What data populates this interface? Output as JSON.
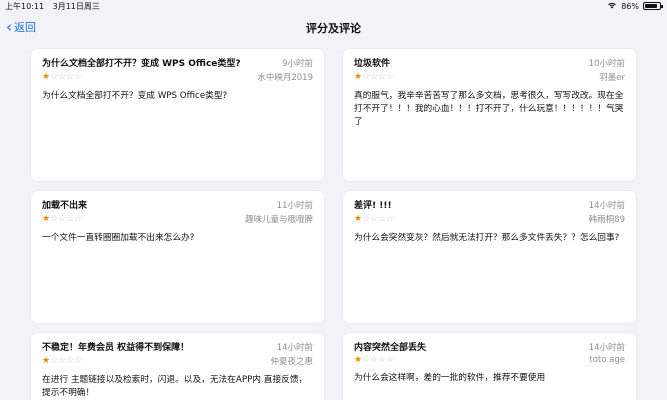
{
  "status_bar": {
    "time": "上午10:11",
    "date": "3月11日周三",
    "battery": "86%",
    "battery_fraction": 0.86
  },
  "nav": {
    "back_label": "返回",
    "title": "评分及评论"
  },
  "reviews": [
    {
      "title": "为什么文档全部打不开？变成 WPS Office类型?",
      "time": "9小时前",
      "author": "水中映月2019",
      "rating": 1,
      "body": "为什么文档全部打不开？变成 WPS Office类型?"
    },
    {
      "title": "垃圾软件",
      "time": "10小时前",
      "author": "羽墨er",
      "rating": 1,
      "body": "真的服气，我辛辛苦苦写了那么多文档，思考很久，写写改改。现在全打不开了！！！我的心血！！！打不开了，什么玩意！！！！！！气哭了"
    },
    {
      "title": "加载不出来",
      "time": "11小时前",
      "author": "趣味儿童与哦哦脾",
      "rating": 1,
      "body": "一个文件一直转圈圈加载不出来怎么办?"
    },
    {
      "title": "差评! !!!",
      "time": "14小时前",
      "author": "韩雨桐89",
      "rating": 1,
      "body": "为什么会突然变灰？然后就无法打开？那么多文件丢失？？怎么回事?"
    },
    {
      "title": "不稳定！年费会员 权益得不到保障！",
      "time": "14小时前",
      "author": "仲夏夜之惠",
      "rating": 1,
      "body": "在进行 主题链接以及检索时，闪退。以及，无法在APP内 直接反馈，提示不明确！"
    },
    {
      "title": "内容突然全部丢失",
      "time": "14小时前",
      "author": "toto age",
      "rating": 1,
      "body": "为什么会这样啊，差的一批的软件，推荐不要使用"
    }
  ]
}
